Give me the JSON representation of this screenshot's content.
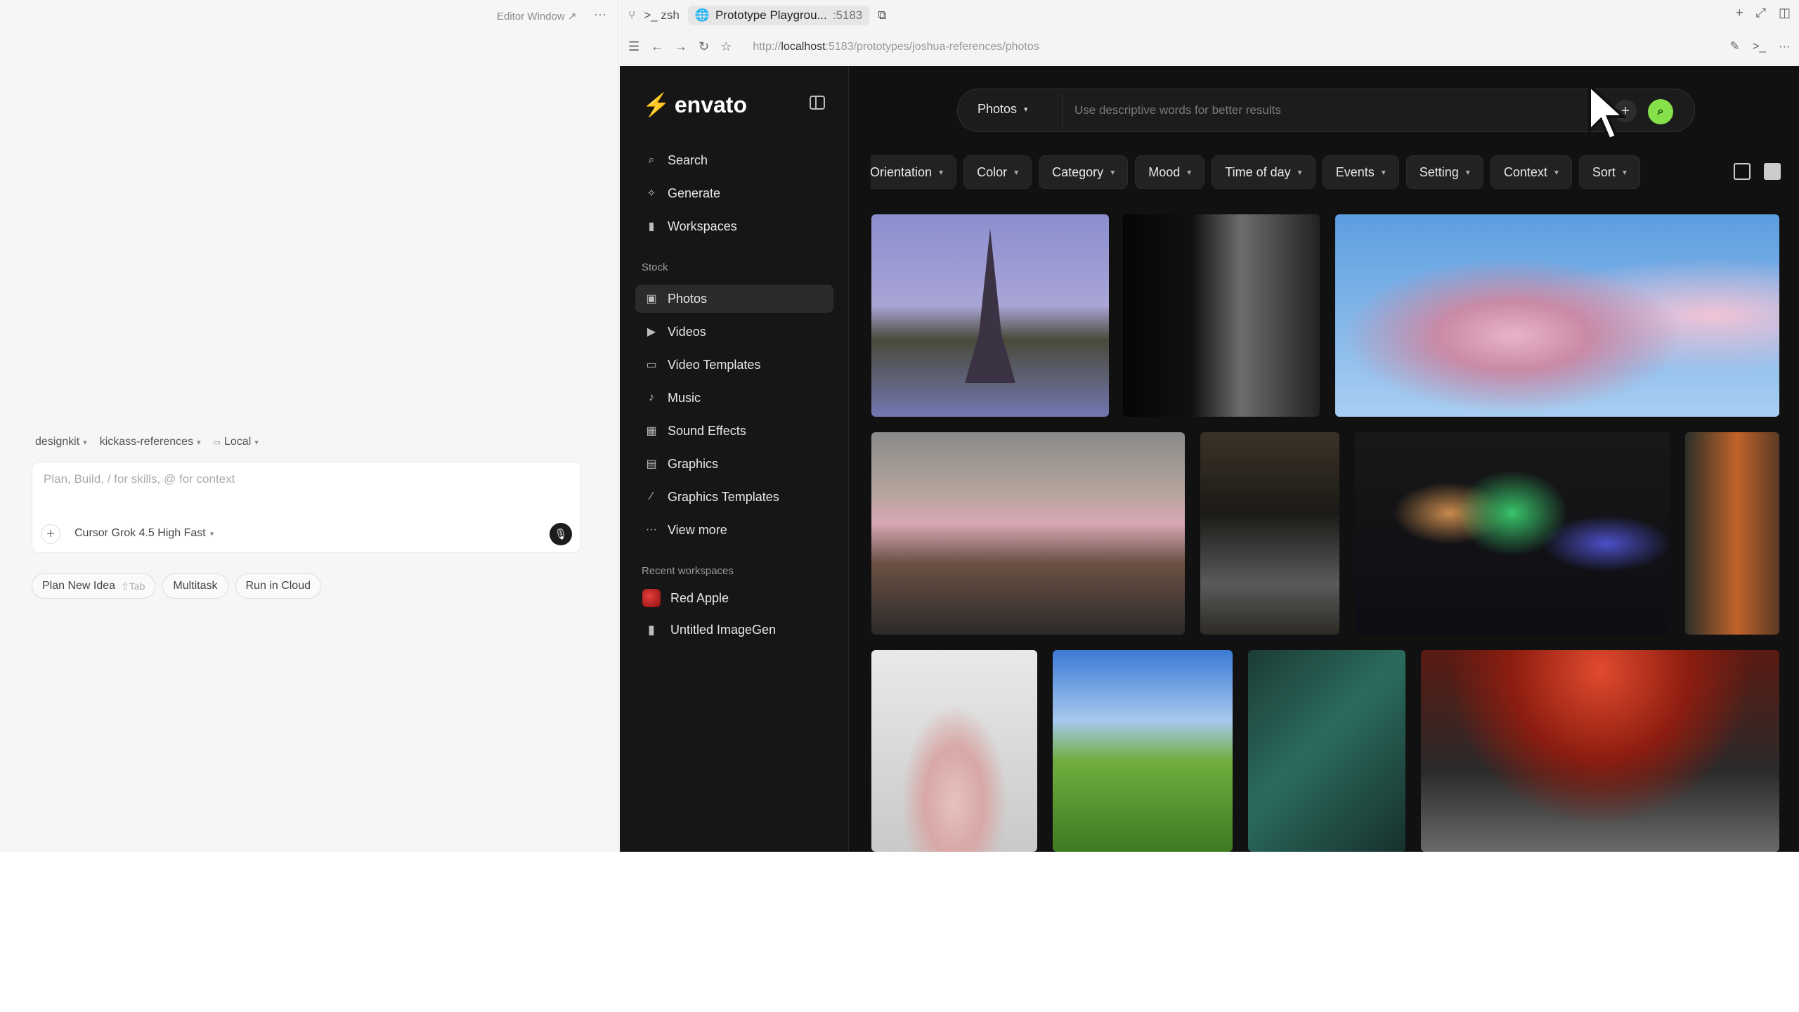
{
  "left": {
    "editor_window": "Editor Window ↗",
    "dots": "···",
    "context": {
      "workspace": "designkit",
      "branch": "kickass-references",
      "env": "Local"
    },
    "composer": {
      "placeholder": "Plan, Build, / for skills, @ for context",
      "model": "Cursor Grok 4.5 High Fast"
    },
    "pills": [
      {
        "label": "Plan New Idea",
        "hint": "⇧Tab"
      },
      {
        "label": "Multitask",
        "hint": ""
      },
      {
        "label": "Run in Cloud",
        "hint": ""
      }
    ]
  },
  "browser": {
    "tabs": {
      "terminal": "zsh",
      "title": "Prototype Playgrou...",
      "port": ":5183"
    },
    "url_host": "localhost",
    "url_prefix": "http://",
    "url_rest": ":5183/prototypes/joshua-references/photos"
  },
  "app": {
    "brand": "envato",
    "nav_top": [
      {
        "label": "Search",
        "icon": "search-icon"
      },
      {
        "label": "Generate",
        "icon": "generate-icon"
      },
      {
        "label": "Workspaces",
        "icon": "bookmark-icon"
      }
    ],
    "stock_label": "Stock",
    "nav_stock": [
      {
        "label": "Photos",
        "icon": "photo-icon"
      },
      {
        "label": "Videos",
        "icon": "video-icon"
      },
      {
        "label": "Video Templates",
        "icon": "folder-icon"
      },
      {
        "label": "Music",
        "icon": "music-icon"
      },
      {
        "label": "Sound Effects",
        "icon": "sound-icon"
      },
      {
        "label": "Graphics",
        "icon": "graphics-icon"
      },
      {
        "label": "Graphics Templates",
        "icon": "wand-icon"
      },
      {
        "label": "View more",
        "icon": "more-icon"
      }
    ],
    "recent_label": "Recent workspaces",
    "recent": [
      "Red Apple",
      "Untitled ImageGen"
    ],
    "search": {
      "type": "Photos",
      "placeholder": "Use descriptive words for better results"
    },
    "filters": [
      "Orientation",
      "Color",
      "Category",
      "Mood",
      "Time of day",
      "Events",
      "Setting",
      "Context",
      "Sort"
    ],
    "accent": "#86e04a"
  }
}
